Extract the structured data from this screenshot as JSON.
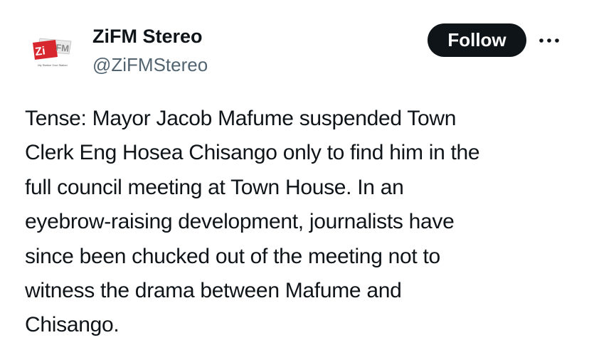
{
  "account": {
    "display_name": "ZiFM Stereo",
    "handle": "@ZiFMStereo",
    "avatar": {
      "logo_text": "ZiFM",
      "tagline": "My Station Your Station"
    }
  },
  "actions": {
    "follow_label": "Follow",
    "more_icon": "more-horizontal-icon"
  },
  "tweet": {
    "text": "Tense: Mayor Jacob Mafume suspended Town\nClerk Eng Hosea Chisango only to find him in the\nfull council meeting at Town House. In an\neyebrow-raising development, journalists have\nsince been chucked out of the meeting not to\nwitness the drama between Mafume and\nChisango."
  },
  "colors": {
    "text": "#0f1419",
    "secondary_text": "#536471",
    "button_bg": "#0f1419",
    "button_text": "#ffffff",
    "logo_red": "#d7262e"
  }
}
